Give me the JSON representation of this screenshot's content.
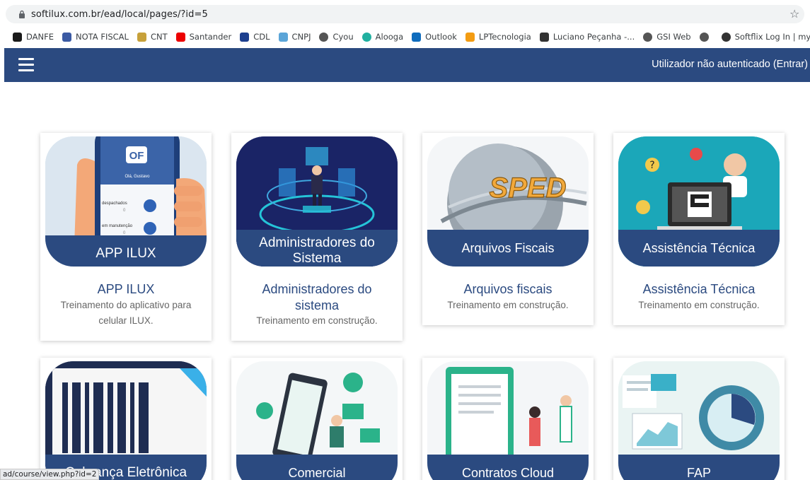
{
  "browser": {
    "url": "softilux.com.br/ead/local/pages/?id=5",
    "bookmarks": [
      {
        "label": "DANFE",
        "icon": "danfe-icon",
        "color": "#1a1a1a"
      },
      {
        "label": "NOTA FISCAL",
        "icon": "nota-fiscal-icon",
        "color": "#3b5aa3"
      },
      {
        "label": "CNT",
        "icon": "cnt-icon",
        "color": "#c7a13a"
      },
      {
        "label": "Santander",
        "icon": "santander-icon",
        "color": "#ec0000"
      },
      {
        "label": "CDL",
        "icon": "cdl-icon",
        "color": "#1d3f8f"
      },
      {
        "label": "CNPJ",
        "icon": "cnpj-icon",
        "color": "#5ba5d8"
      },
      {
        "label": "Cyou",
        "icon": "globe-icon",
        "color": "#555555"
      },
      {
        "label": "Alooga",
        "icon": "alooga-icon",
        "color": "#20b0a0"
      },
      {
        "label": "Outlook",
        "icon": "outlook-icon",
        "color": "#0f6cbd"
      },
      {
        "label": "LPTecnologia",
        "icon": "lptecnologia-icon",
        "color": "#f39c12"
      },
      {
        "label": "Luciano Peçanha -...",
        "icon": "luciano-icon",
        "color": "#333333"
      },
      {
        "label": "GSI Web",
        "icon": "globe-icon",
        "color": "#555555"
      },
      {
        "label": "",
        "icon": "globe-icon",
        "color": "#555555"
      },
      {
        "label": "Softflix Log In | myB",
        "icon": "smiley-icon",
        "color": "#333333"
      }
    ],
    "status_url": "ad/course/view.php?id=2"
  },
  "nav": {
    "login_text": "Utilizador não autenticado (Entrar)"
  },
  "cards": [
    {
      "band": "APP ILUX",
      "title": "APP ILUX",
      "desc": "Treinamento do aplicativo para celular ILUX."
    },
    {
      "band": "Administradores do Sistema",
      "title": "Administradores do sistema",
      "desc": "Treinamento em construção."
    },
    {
      "band": "Arquivos Fiscais",
      "title": "Arquivos fiscais",
      "desc": "Treinamento em construção."
    },
    {
      "band": "Assistência Técnica",
      "title": "Assistência Técnica",
      "desc": "Treinamento em construção."
    },
    {
      "band": "Cobrança Eletrônica",
      "title": "",
      "desc": ""
    },
    {
      "band": "Comercial",
      "title": "",
      "desc": ""
    },
    {
      "band": "Contratos Cloud",
      "title": "",
      "desc": ""
    },
    {
      "band": "FAP",
      "title": "",
      "desc": ""
    }
  ],
  "app_screen": {
    "logo": "OF",
    "greeting": "Olá, Gustavo",
    "row1": "despachados",
    "row1_value": "0",
    "row2": "em manutenção",
    "row2_value": "0"
  },
  "sped_text": "SPED",
  "colors": {
    "primary": "#2b4a80"
  }
}
